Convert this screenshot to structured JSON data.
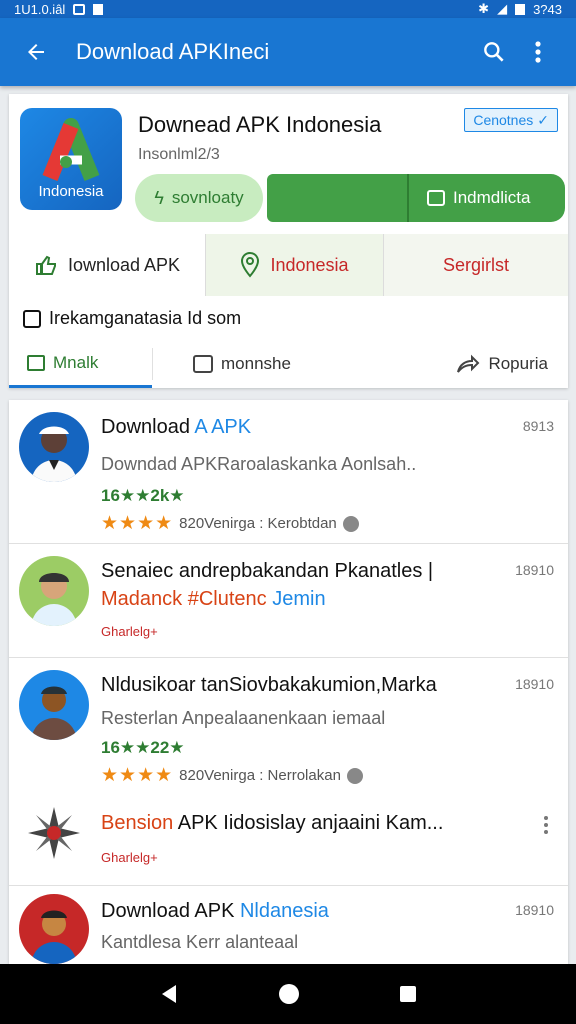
{
  "status": {
    "left_text": "1U1.0.iâl",
    "right_text": "3?43"
  },
  "appbar": {
    "title": "Download APKIneci"
  },
  "header": {
    "app_title": "Downead APK Indonesia",
    "app_sub": "Insonlml2/3",
    "logo_text": "Indonesia",
    "category_badge": "Cenotnes",
    "btn_light": "sovnloaty",
    "btn_install": "Indmdlicta",
    "seg_download": "Iownload APK",
    "seg_indonesia": "Indonesia",
    "seg_third": "Sergirlst",
    "info_line": "Irekamganatasia Id som",
    "tab_main": "Mnalk",
    "tab_mid": "monnshe",
    "tab_popular": "Ropuria"
  },
  "list": [
    {
      "title_a": "Download ",
      "title_b": "A APK",
      "desc": "Downdad APKRaroalaskanka Aonlsah..",
      "rating": "16★★2k★",
      "stars": "★★★★",
      "meta": "820Venirga : Kerobtdan",
      "num": "8913"
    },
    {
      "title": "Senaiec andrepbakandan Pkanatles |",
      "sub_a": "Madanck #Clutenc",
      "sub_b": " Jemin",
      "tag": "Gharlelg+",
      "num": "18910"
    },
    {
      "title": "Nldusikoar tanSiovbakakumion,Marka",
      "desc": "Resterlan Anpealaanenkaan iemaal",
      "rating": "16★★22★",
      "stars": "★★★★",
      "meta": "820Venirga : Nerrolakan",
      "num": "18910"
    },
    {
      "title_a": "Bension",
      "title_b": " APK Iidosislay anjaaini Kam...",
      "tag": "Gharlelg+"
    },
    {
      "title_a": "Download APK ",
      "title_b": "Nldanesia",
      "desc": "Kantdlesa Kerr alanteaal",
      "num": "18910"
    }
  ]
}
